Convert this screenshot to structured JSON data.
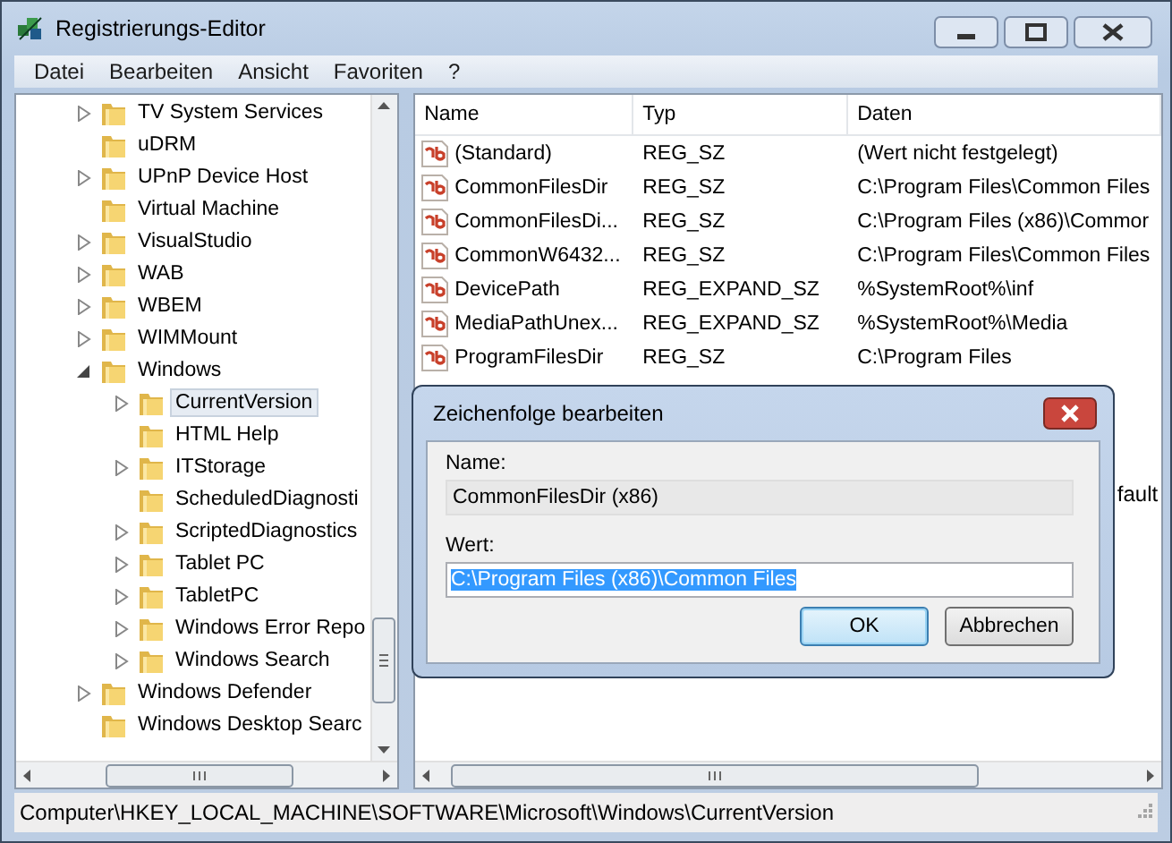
{
  "window": {
    "title": "Registrierungs-Editor"
  },
  "menu": [
    "Datei",
    "Bearbeiten",
    "Ansicht",
    "Favoriten",
    "?"
  ],
  "tree": {
    "items": [
      {
        "label": "TV System Services",
        "expanded": false,
        "selected": false
      },
      {
        "label": "uDRM",
        "selected": false
      },
      {
        "label": "UPnP Device Host",
        "expanded": false,
        "selected": false
      },
      {
        "label": "Virtual Machine",
        "selected": false
      },
      {
        "label": "VisualStudio",
        "expanded": false,
        "selected": false
      },
      {
        "label": "WAB",
        "expanded": false,
        "selected": false
      },
      {
        "label": "WBEM",
        "expanded": false,
        "selected": false
      },
      {
        "label": "WIMMount",
        "expanded": false,
        "selected": false
      },
      {
        "label": "Windows",
        "expanded": true,
        "selected": false,
        "children": [
          {
            "label": "CurrentVersion",
            "expanded": false,
            "selected": true
          },
          {
            "label": "HTML Help",
            "selected": false
          },
          {
            "label": "ITStorage",
            "expanded": false,
            "selected": false
          },
          {
            "label": "ScheduledDiagnosti",
            "selected": false
          },
          {
            "label": "ScriptedDiagnostics",
            "expanded": false,
            "selected": false
          },
          {
            "label": "Tablet PC",
            "expanded": false,
            "selected": false
          },
          {
            "label": "TabletPC",
            "expanded": false,
            "selected": false
          },
          {
            "label": "Windows Error Repo",
            "expanded": false,
            "selected": false
          },
          {
            "label": "Windows Search",
            "expanded": false,
            "selected": false
          }
        ]
      },
      {
        "label": "Windows Defender",
        "expanded": false,
        "selected": false
      },
      {
        "label": "Windows Desktop Searc",
        "selected": false
      }
    ]
  },
  "list": {
    "columns": [
      "Name",
      "Typ",
      "Daten"
    ],
    "rows": [
      {
        "kind": "full",
        "name": "(Standard)",
        "type": "REG_SZ",
        "data": "(Wert nicht festgelegt)"
      },
      {
        "kind": "full",
        "name": "CommonFilesDir",
        "type": "REG_SZ",
        "data": "C:\\Program Files\\Common Files"
      },
      {
        "kind": "full",
        "name": "CommonFilesDi...",
        "type": "REG_SZ",
        "data": "C:\\Program Files (x86)\\Commor"
      },
      {
        "kind": "full",
        "name": "CommonW6432...",
        "type": "REG_SZ",
        "data": "C:\\Program Files\\Common Files"
      },
      {
        "kind": "full",
        "name": "DevicePath",
        "type": "REG_EXPAND_SZ",
        "data": "%SystemRoot%\\inf"
      },
      {
        "kind": "full",
        "name": "MediaPathUnex...",
        "type": "REG_EXPAND_SZ",
        "data": "%SystemRoot%\\Media"
      },
      {
        "kind": "full",
        "name": "ProgramFilesDir",
        "type": "REG_SZ",
        "data": "C:\\Program Files"
      },
      {
        "kind": "clipped",
        "data": "fault"
      }
    ]
  },
  "dialog": {
    "title": "Zeichenfolge bearbeiten",
    "name_label": "Name:",
    "name_value": "CommonFilesDir (x86)",
    "value_label": "Wert:",
    "value": "C:\\Program Files (x86)\\Common Files",
    "buttons": [
      {
        "label": "OK",
        "default": true
      },
      {
        "label": "Abbrechen",
        "default": false
      }
    ]
  },
  "status_bar": "Computer\\HKEY_LOCAL_MACHINE\\SOFTWARE\\Microsoft\\Windows\\CurrentVersion"
}
